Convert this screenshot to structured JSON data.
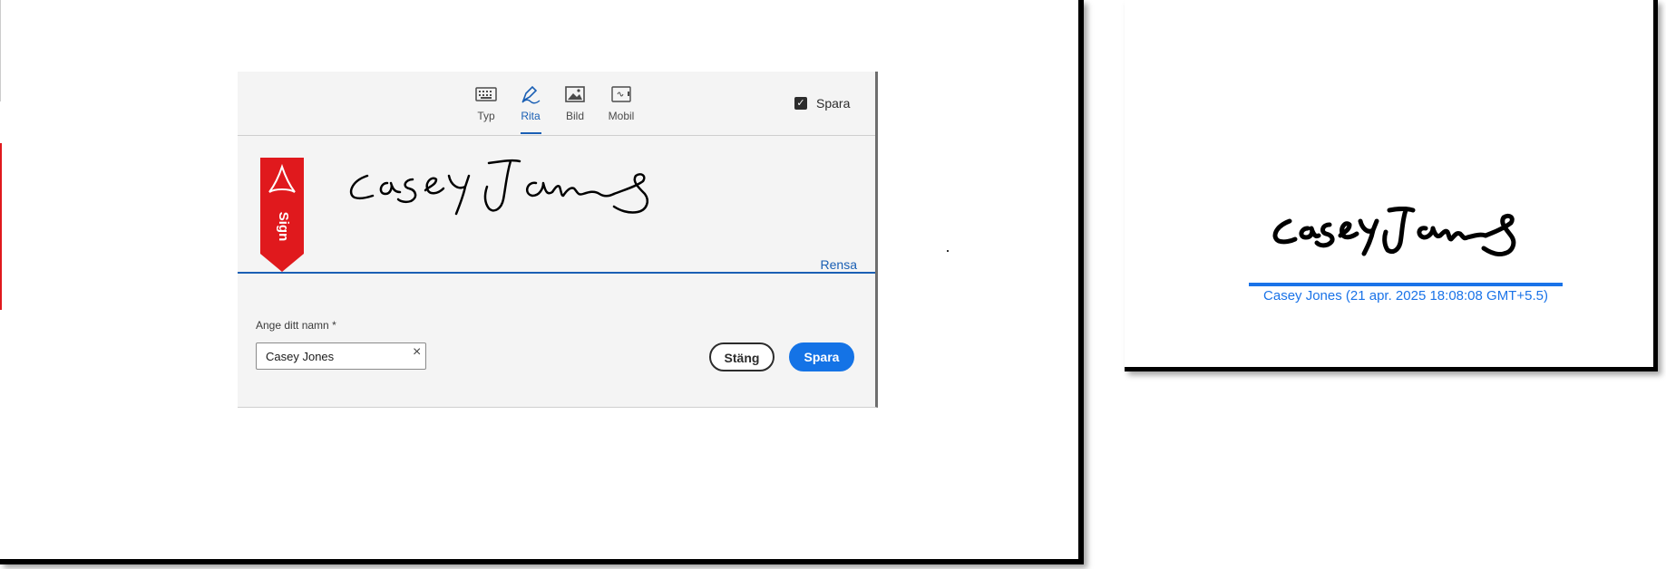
{
  "dialog": {
    "tabs": [
      {
        "label": "Typ",
        "icon": "keyboard-icon"
      },
      {
        "label": "Rita",
        "icon": "pen-icon",
        "active": true
      },
      {
        "label": "Bild",
        "icon": "image-icon"
      },
      {
        "label": "Mobil",
        "icon": "mobile-icon"
      }
    ],
    "save_checkbox_label": "Spara",
    "save_checked": true,
    "sign_flag_label": "Sign",
    "clear_label": "Rensa",
    "name_label": "Ange ditt namn",
    "required_mark": "*",
    "name_value": "Casey Jones",
    "close_button": "Stäng",
    "save_button": "Spara"
  },
  "preview": {
    "caption": "Casey Jones (21 apr. 2025 18:08:08 GMT+5.5)"
  },
  "colors": {
    "accent": "#1473e6",
    "link": "#1a5fb4",
    "brand_red": "#e0191d"
  }
}
